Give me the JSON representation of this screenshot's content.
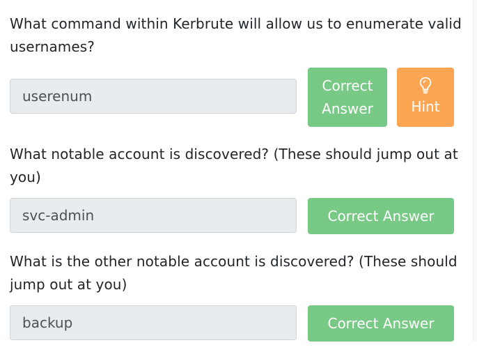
{
  "colors": {
    "success": "#78c886",
    "warning": "#fca553",
    "field_bg": "#e9ecef",
    "text": "#212529"
  },
  "questions": [
    {
      "text": "What command within Kerbrute will allow us to enumerate valid usernames?",
      "answer": "userenum",
      "submit_label": "Correct Answer",
      "hint_label": "Hint",
      "hint_icon": "lightbulb-icon"
    },
    {
      "text": "What notable account is discovered? (These should jump out at you)",
      "answer": "svc-admin",
      "submit_label": "Correct Answer"
    },
    {
      "text": "What is the other notable account is discovered? (These should jump out at you)",
      "answer": "backup",
      "submit_label": "Correct Answer"
    }
  ]
}
